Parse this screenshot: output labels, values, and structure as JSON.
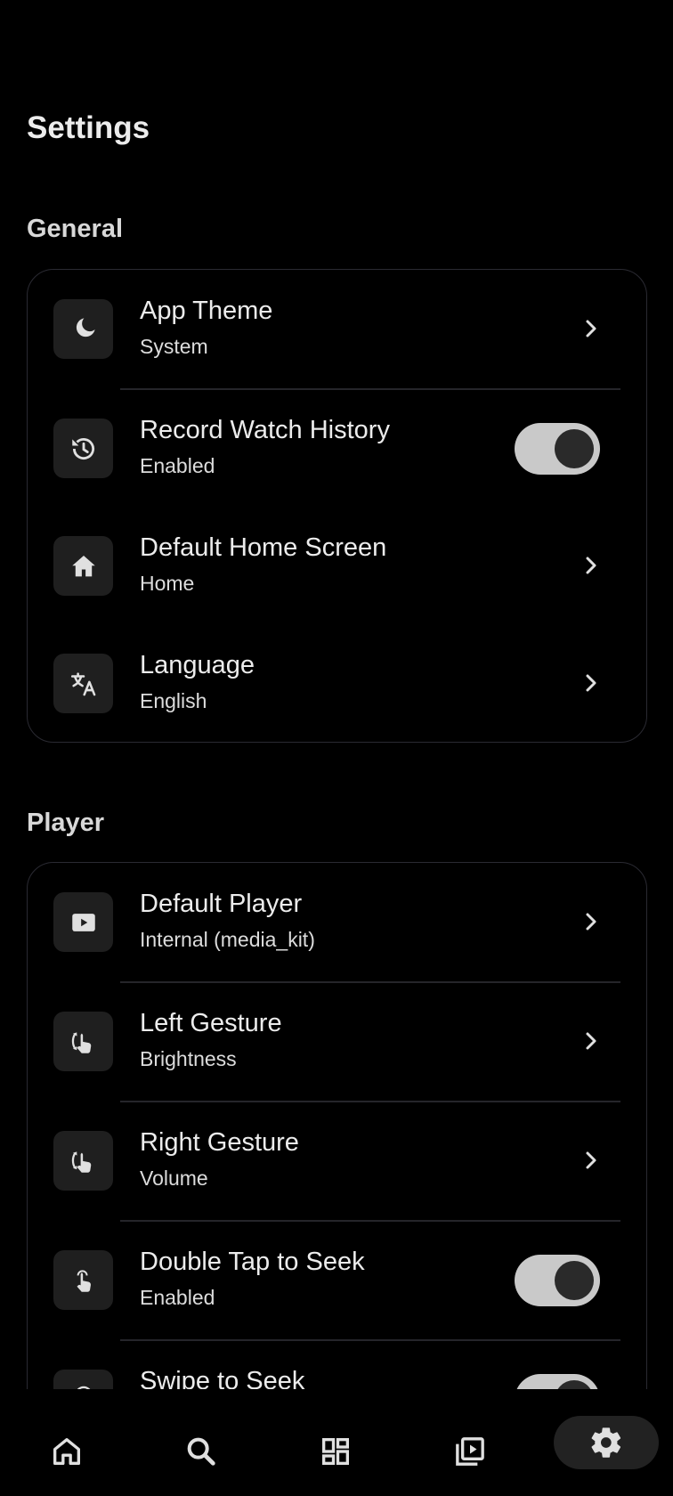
{
  "header": {
    "title": "Settings"
  },
  "sections": {
    "general": {
      "title": "General",
      "items": [
        {
          "title": "App Theme",
          "subtitle": "System",
          "icon": "moon-icon",
          "control": "chevron"
        },
        {
          "title": "Record Watch History",
          "subtitle": "Enabled",
          "icon": "history-icon",
          "control": "toggle",
          "value": true
        },
        {
          "title": "Default Home Screen",
          "subtitle": "Home",
          "icon": "home-icon",
          "control": "chevron"
        },
        {
          "title": "Language",
          "subtitle": "English",
          "icon": "translate-icon",
          "control": "chevron"
        }
      ]
    },
    "player": {
      "title": "Player",
      "items": [
        {
          "title": "Default Player",
          "subtitle": "Internal (media_kit)",
          "icon": "play-icon",
          "control": "chevron"
        },
        {
          "title": "Left Gesture",
          "subtitle": "Brightness",
          "icon": "swipe-gesture-icon",
          "control": "chevron"
        },
        {
          "title": "Right Gesture",
          "subtitle": "Volume",
          "icon": "swipe-gesture-icon",
          "control": "chevron"
        },
        {
          "title": "Double Tap to Seek",
          "subtitle": "Enabled",
          "icon": "tap-icon",
          "control": "toggle",
          "value": true
        },
        {
          "title": "Swipe to Seek",
          "subtitle": "",
          "icon": "swipe-icon",
          "control": "toggle",
          "value": true
        }
      ]
    }
  },
  "bottom_nav": {
    "items": [
      {
        "icon": "home-icon",
        "active": false
      },
      {
        "icon": "search-icon",
        "active": false
      },
      {
        "icon": "dashboard-icon",
        "active": false
      },
      {
        "icon": "video-library-icon",
        "active": false
      },
      {
        "icon": "settings-gear-icon",
        "active": true
      }
    ]
  },
  "colors": {
    "background": "#000000",
    "card_border": "#2a2a32",
    "icon_box": "#1f1f1f",
    "toggle_track": "#c9c9c9",
    "toggle_knob": "#2a2a2a",
    "nav_active": "#222222"
  }
}
